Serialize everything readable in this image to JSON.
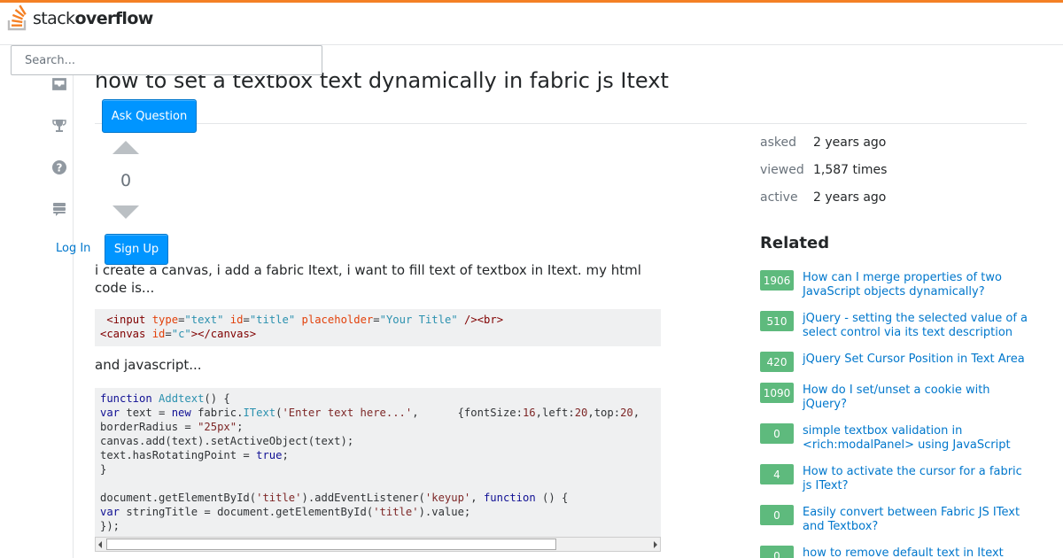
{
  "header": {
    "logo_word1": "stack",
    "logo_word2": "overflow",
    "search_placeholder": "Search...",
    "brand_color": "#f48024"
  },
  "sidebar": {
    "icons": [
      "inbox-icon",
      "trophy-icon",
      "help-icon",
      "review-queue-icon"
    ],
    "login_label": "Log In",
    "signup_label": "Sign Up",
    "ask_label": "Ask Question"
  },
  "question": {
    "title": "how to set a textbox text dynamically in fabric js Itext",
    "votes": "0",
    "body_intro": "i create a canvas, i add a fabric Itext, i want to fill text of textbox in Itext. my html code is...",
    "body_js_intro": "and javascript..."
  },
  "stats": [
    {
      "label": "asked",
      "value": "2 years ago"
    },
    {
      "label": "viewed",
      "value": "1,587 times"
    },
    {
      "label": "active",
      "value": "2 years ago"
    }
  ],
  "related": {
    "heading": "Related",
    "items": [
      {
        "score": "1906",
        "title": "How can I merge properties of two JavaScript objects dynamically?"
      },
      {
        "score": "510",
        "title": "jQuery - setting the selected value of a select control via its text description"
      },
      {
        "score": "420",
        "title": "jQuery Set Cursor Position in Text Area"
      },
      {
        "score": "1090",
        "title": "How do I set/unset a cookie with jQuery?"
      },
      {
        "score": "0",
        "title": "simple textbox validation in <rich:modalPanel> using JavaScript"
      },
      {
        "score": "4",
        "title": "How to activate the cursor for a fabric js IText?"
      },
      {
        "score": "0",
        "title": "Easily convert between Fabric JS IText and Textbox?"
      },
      {
        "score": "0",
        "title": "how to remove default text in Itext"
      }
    ]
  },
  "colors": {
    "accent": "#0095ff",
    "link": "#0077cc",
    "answered_badge": "#5eba7d"
  }
}
